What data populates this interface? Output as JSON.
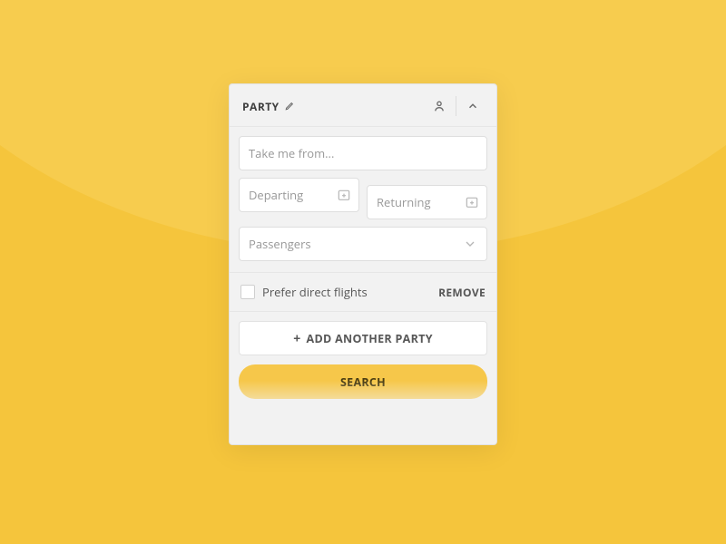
{
  "header": {
    "title": "PARTY"
  },
  "fields": {
    "from_placeholder": "Take me from...",
    "departing_label": "Departing",
    "returning_label": "Returning",
    "passengers_label": "Passengers"
  },
  "options": {
    "direct_label": "Prefer direct flights",
    "remove_label": "REMOVE"
  },
  "buttons": {
    "add_party_label": "ADD ANOTHER PARTY",
    "search_label": "SEARCH"
  }
}
